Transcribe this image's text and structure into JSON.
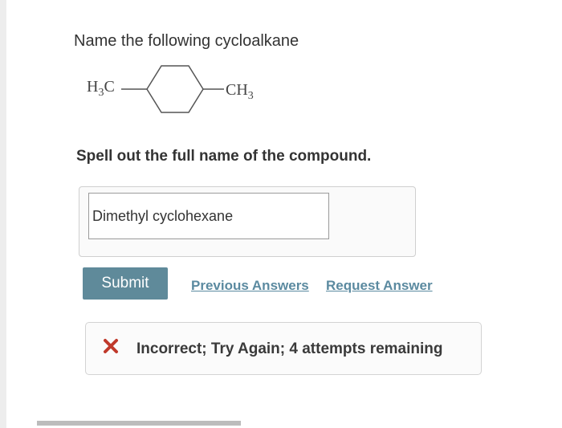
{
  "question": {
    "title": "Name the following cycloalkane",
    "molecule": {
      "left_group": {
        "main": "H",
        "sub": "3",
        "tail": "C"
      },
      "right_group": {
        "main": "CH",
        "sub": "3"
      }
    },
    "instruction": "Spell out the full name of the compound."
  },
  "answer": {
    "value": "Dimethyl cyclohexane"
  },
  "actions": {
    "submit_label": "Submit",
    "previous_answers_label": "Previous Answers",
    "request_answer_label": "Request Answer"
  },
  "feedback": {
    "icon": "x-icon",
    "icon_color": "#c0392b",
    "text": "Incorrect; Try Again; 4 attempts remaining"
  }
}
